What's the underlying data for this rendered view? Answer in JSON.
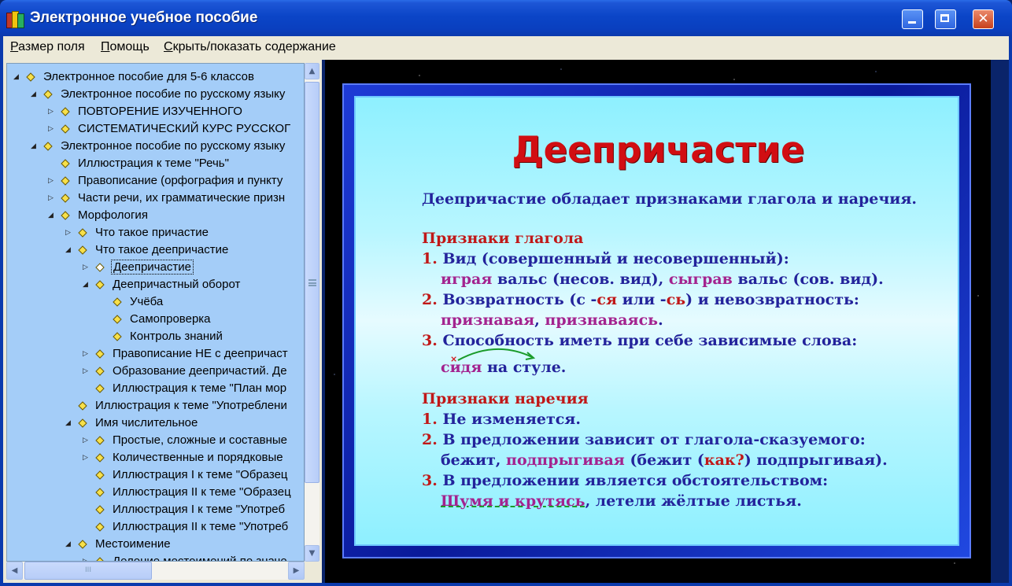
{
  "window": {
    "title": "Электронное учебное пособие",
    "close_glyph": "✕"
  },
  "menu": {
    "items": [
      "Размер поля",
      "Помощь",
      "Скрыть/показать содержание"
    ]
  },
  "tree": {
    "items": [
      {
        "label": "Электронное пособие для 5-6 классов",
        "level": 0,
        "expander": "open"
      },
      {
        "label": "Электронное пособие по русскому языку",
        "level": 1,
        "expander": "open"
      },
      {
        "label": "ПОВТОРЕНИЕ ИЗУЧЕННОГО",
        "level": 2,
        "expander": "closed"
      },
      {
        "label": "СИСТЕМАТИЧЕСКИЙ КУРС РУССКОГ",
        "level": 2,
        "expander": "closed"
      },
      {
        "label": "Электронное пособие по русскому языку",
        "level": 1,
        "expander": "open"
      },
      {
        "label": "Иллюстрация к теме \"Речь\"",
        "level": 2,
        "expander": "none"
      },
      {
        "label": "Правописание (орфография и пункту",
        "level": 2,
        "expander": "closed"
      },
      {
        "label": "Части речи, их грамматические призн",
        "level": 2,
        "expander": "closed"
      },
      {
        "label": "Морфология",
        "level": 2,
        "expander": "open"
      },
      {
        "label": "Что такое причастие",
        "level": 3,
        "expander": "closed"
      },
      {
        "label": "Что такое деепричастие",
        "level": 3,
        "expander": "open"
      },
      {
        "label": "Деепричастие",
        "level": 4,
        "expander": "closed",
        "selected": true
      },
      {
        "label": "Деепричастный оборот",
        "level": 4,
        "expander": "open"
      },
      {
        "label": "Учёба",
        "level": 5,
        "expander": "none"
      },
      {
        "label": "Самопроверка",
        "level": 5,
        "expander": "none"
      },
      {
        "label": "Контроль знаний",
        "level": 5,
        "expander": "none"
      },
      {
        "label": "Правописание НЕ с деепричаст",
        "level": 4,
        "expander": "closed"
      },
      {
        "label": "Образование деепричастий. Де",
        "level": 4,
        "expander": "closed"
      },
      {
        "label": "Иллюстрация к теме \"План мор",
        "level": 4,
        "expander": "none"
      },
      {
        "label": "Иллюстрация к теме \"Употреблени",
        "level": 3,
        "expander": "none"
      },
      {
        "label": "Имя числительное",
        "level": 3,
        "expander": "open"
      },
      {
        "label": "Простые, сложные и составные",
        "level": 4,
        "expander": "closed"
      },
      {
        "label": "Количественные и порядковые",
        "level": 4,
        "expander": "closed"
      },
      {
        "label": "Иллюстрация I к теме \"Образец",
        "level": 4,
        "expander": "none"
      },
      {
        "label": "Иллюстрация II к теме \"Образец",
        "level": 4,
        "expander": "none"
      },
      {
        "label": "Иллюстрация I к теме \"Употреб",
        "level": 4,
        "expander": "none"
      },
      {
        "label": "Иллюстрация II к теме \"Употреб",
        "level": 4,
        "expander": "none"
      },
      {
        "label": "Местоимение",
        "level": 3,
        "expander": "open"
      },
      {
        "label": "Деление местоимений по значе",
        "level": 4,
        "expander": "closed"
      }
    ],
    "scroll_up": "▲",
    "scroll_down": "▼",
    "scroll_left": "◀",
    "scroll_right": "▶",
    "hthumb_grip": "III"
  },
  "slide": {
    "title": "Деепричастие",
    "intro": "Деепричастие обладает признаками глагола и наречия.",
    "verb_heading": "Признаки глагола",
    "verb_1_num": "1.",
    "verb_1_text": "Вид (совершенный и несовершенный):",
    "verb_1_ex_a": "играя",
    "verb_1_ex_b": " вальс (несов. вид), ",
    "verb_1_ex_c": "сыграв",
    "verb_1_ex_d": " вальс (сов. вид).",
    "verb_2_num": "2.",
    "verb_2_text_a": "Возвратность (с -",
    "verb_2_text_b": "ся",
    "verb_2_text_c": " или -",
    "verb_2_text_d": "сь",
    "verb_2_text_e": ") и невозвратность:",
    "verb_2_ex_a": "признавая",
    "verb_2_ex_b": ", ",
    "verb_2_ex_c": "признаваясь",
    "verb_2_ex_d": ".",
    "verb_3_num": "3.",
    "verb_3_text": "Способность иметь при себе зависимые слова:",
    "verb_3_ex_a": "сидя",
    "verb_3_ex_b": " на стуле.",
    "verb_3_mark": "×",
    "adv_heading": "Признаки наречия",
    "adv_1_num": "1.",
    "adv_1_text": "Не изменяется.",
    "adv_2_num": "2.",
    "adv_2_text": "В предложении зависит от глагола-сказуемого:",
    "adv_2_ex_a": "бежит, ",
    "adv_2_ex_b": "подпрыгивая",
    "adv_2_ex_c": " (бежит (",
    "adv_2_ex_d": "как?",
    "adv_2_ex_e": ") подпрыгивая).",
    "adv_3_num": "3.",
    "adv_3_text": "В предложении является обстоятельством:",
    "adv_3_ex_a": "Шумя и крутясь",
    "adv_3_ex_b": ", летели жёлтые листья."
  }
}
